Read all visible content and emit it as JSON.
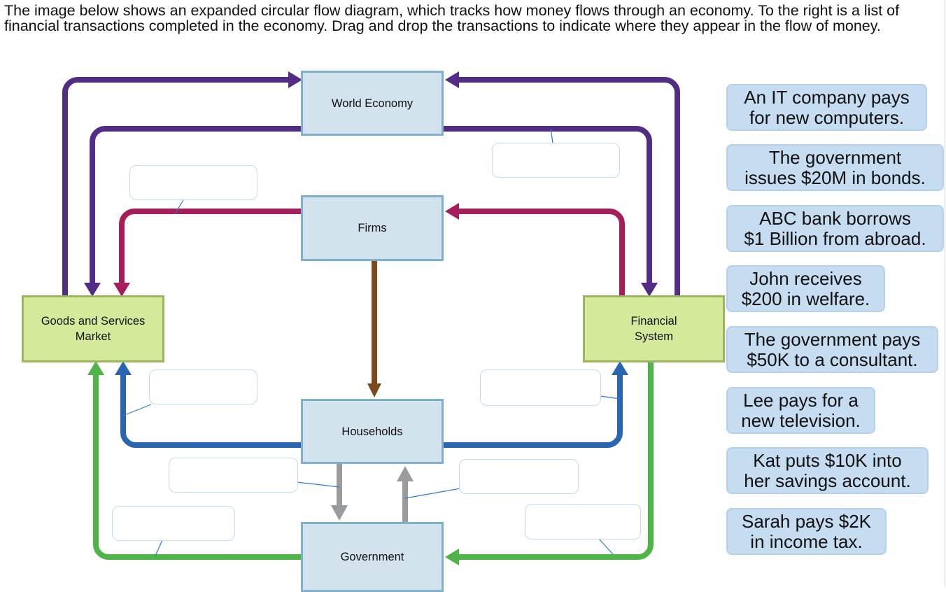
{
  "instructions": "The image below shows an expanded circular flow diagram, which tracks how money flows through an economy. To the right is a list of financial transactions completed in the economy. Drag and drop the transactions to indicate where they appear in the flow of money.",
  "colors": {
    "world_flow": "#522d85",
    "firms_flow": "#a51e5a",
    "wages_flow": "#7a4a1e",
    "household_flow": "#2a65b1",
    "government_flow": "#4fb548",
    "tax_transfer_flow": "#9a9b9d",
    "leader_line": "#2a7bd6",
    "sector_fill": "#d3e3ee",
    "market_fill": "#d5e99b",
    "card_fill": "#c6dcf1"
  },
  "nodes": {
    "world_economy": "World Economy",
    "firms": "Firms",
    "goods_market_line1": "Goods and Services",
    "goods_market_line2": "Market",
    "financial_line1": "Financial",
    "financial_line2": "System",
    "households": "Households",
    "government": "Government"
  },
  "drop_zones": [
    {
      "id": "world-to-financial",
      "label": ""
    },
    {
      "id": "firms-to-goods",
      "label": ""
    },
    {
      "id": "households-to-goods",
      "label": ""
    },
    {
      "id": "households-to-financial",
      "label": ""
    },
    {
      "id": "households-to-government",
      "label": ""
    },
    {
      "id": "government-to-households",
      "label": ""
    },
    {
      "id": "government-to-goods",
      "label": ""
    },
    {
      "id": "financial-to-government",
      "label": ""
    }
  ],
  "transactions": [
    {
      "line1": "An IT company pays",
      "line2": "for new computers."
    },
    {
      "line1": "The government",
      "line2": "issues $20M in bonds."
    },
    {
      "line1": "ABC bank borrows",
      "line2": "$1 Billion from abroad."
    },
    {
      "line1": "John receives",
      "line2": "$200 in welfare."
    },
    {
      "line1": "The government pays",
      "line2": "$50K to a consultant."
    },
    {
      "line1": "Lee pays for a",
      "line2": "new television."
    },
    {
      "line1": "Kat puts $10K into",
      "line2": "her savings account."
    },
    {
      "line1": "Sarah pays $2K",
      "line2": "in income tax."
    }
  ]
}
